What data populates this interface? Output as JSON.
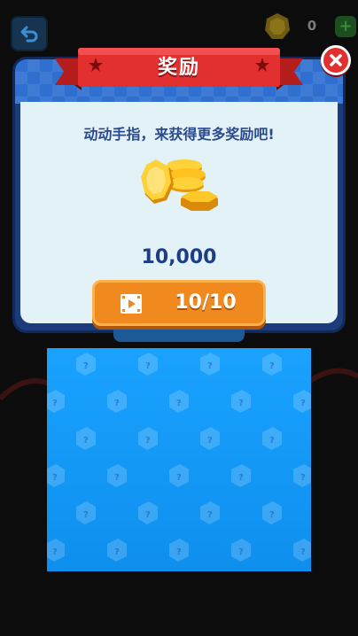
{
  "topbar": {
    "coin_count": "0",
    "plus_label": "+"
  },
  "dialog": {
    "title": "奖励",
    "message": "动动手指，来获得更多奖励吧!",
    "reward_amount": "10,000",
    "watch_button": {
      "count_label": "10/10",
      "icon": "video-icon"
    },
    "close_icon": "close-icon"
  },
  "colors": {
    "ribbon_red": "#e23030",
    "header_blue": "#2f6fd0",
    "body_bg": "#e3f2f7",
    "button_orange": "#f08a1f",
    "text_blue": "#2b4a8e",
    "banner_blue": "#1aa2ff"
  }
}
